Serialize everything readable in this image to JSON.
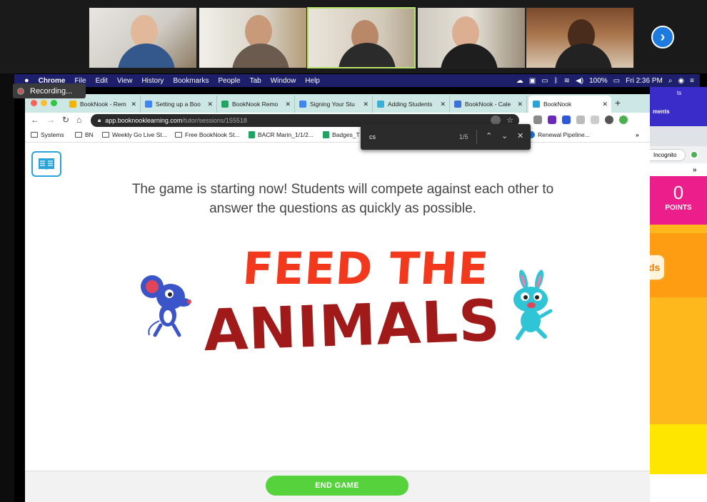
{
  "gallery": {
    "participants": [
      {
        "name": "participant-1"
      },
      {
        "name": "participant-2"
      },
      {
        "name": "participant-3"
      },
      {
        "name": "participant-4"
      },
      {
        "name": "participant-5"
      }
    ],
    "next_icon": "chevron-right-icon"
  },
  "recording": {
    "label": "Recording..."
  },
  "menubar": {
    "apple": "",
    "items": [
      "Chrome",
      "File",
      "Edit",
      "View",
      "History",
      "Bookmarks",
      "People",
      "Tab",
      "Window",
      "Help"
    ],
    "battery": "100%",
    "clock": "Fri 2:36 PM"
  },
  "tabs": [
    {
      "label": "BookNook - Rem",
      "color": "#f4b400"
    },
    {
      "label": "Setting up a Boo",
      "color": "#4285f4"
    },
    {
      "label": "BookNook Remo",
      "color": "#1fa463"
    },
    {
      "label": "Signing Your Stu",
      "color": "#4285f4"
    },
    {
      "label": "Adding Students",
      "color": "#3ab0d8"
    },
    {
      "label": "BookNook - Cale",
      "color": "#3d6fd8"
    },
    {
      "label": "BookNook",
      "color": "#2aa3d8"
    }
  ],
  "toolbar": {
    "url_host": "app.booknooklearning.com",
    "url_path": "/tutor/sessions/155518"
  },
  "bookmarks": [
    {
      "label": "Systems",
      "icon": "folder"
    },
    {
      "label": "BN",
      "icon": "folder"
    },
    {
      "label": "Weekly Go Live St...",
      "icon": "folder"
    },
    {
      "label": "Free BookNook St...",
      "icon": "folder"
    },
    {
      "label": "BACR Marin_1/1/2...",
      "icon": "sheet"
    },
    {
      "label": "Badges_T",
      "icon": "sheet"
    },
    {
      "label": "Renewal Pipeline...",
      "icon": "blue"
    },
    {
      "label": "»",
      "icon": ""
    }
  ],
  "find": {
    "query": "cs",
    "count": "1/5"
  },
  "game": {
    "intro": "The game is starting now! Students will compete against each other to answer the questions as quickly as possible.",
    "title_line1": "FEED THE",
    "title_line2": "ANIMALS",
    "end_button": "END GAME"
  },
  "background_app": {
    "header_small": "ts",
    "header_text": "ments",
    "incognito": "Incognito",
    "more": "»",
    "points_value": "0",
    "points_label": "POINTS",
    "pill_text": "ds"
  },
  "colors": {
    "menubar": "#1e1f6a",
    "tabstrip": "#cde7e4",
    "end_button": "#55d23c",
    "title_red": "#f2391d",
    "title_dark": "#a01a1a",
    "points_pink": "#ec1e8c"
  }
}
